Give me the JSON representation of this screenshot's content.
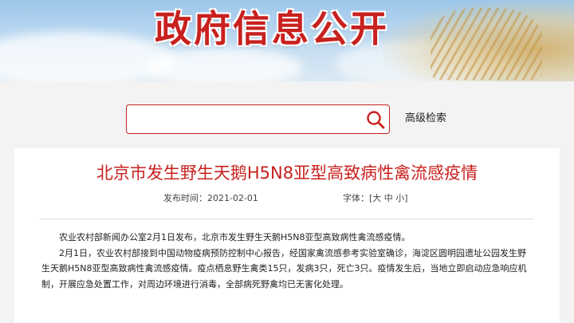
{
  "banner": {
    "title": "政府信息公开"
  },
  "search": {
    "value": "",
    "placeholder": "",
    "advanced_label": "高级检索"
  },
  "article": {
    "title": "北京市发生野生天鹅H5N8亚型高致病性禽流感疫情",
    "publish_label": "发布时间：",
    "publish_date": "2021-02-01",
    "font_label": "字体：",
    "font_open": "[",
    "font_large": "大",
    "font_medium": "中",
    "font_small": "小",
    "font_close": "]",
    "paragraphs": [
      "农业农村部新闻办公室2月1日发布，北京市发生野生天鹅H5N8亚型高致病性禽流感疫情。",
      "2月1日，农业农村部接到中国动物疫病预防控制中心报告，经国家禽流感参考实验室确诊，海淀区圆明园遗址公园发生野生天鹅H5N8亚型高致病性禽流感疫情。疫点栖息野生禽类15只，发病3只，死亡3只。疫情发生后，当地立即启动应急响应机制，开展应急处置工作，对周边环境进行消毒，全部病死野禽均已无害化处理。"
    ]
  },
  "colors": {
    "accent": "#c8211f",
    "page_bg": "#f3f3f3"
  }
}
